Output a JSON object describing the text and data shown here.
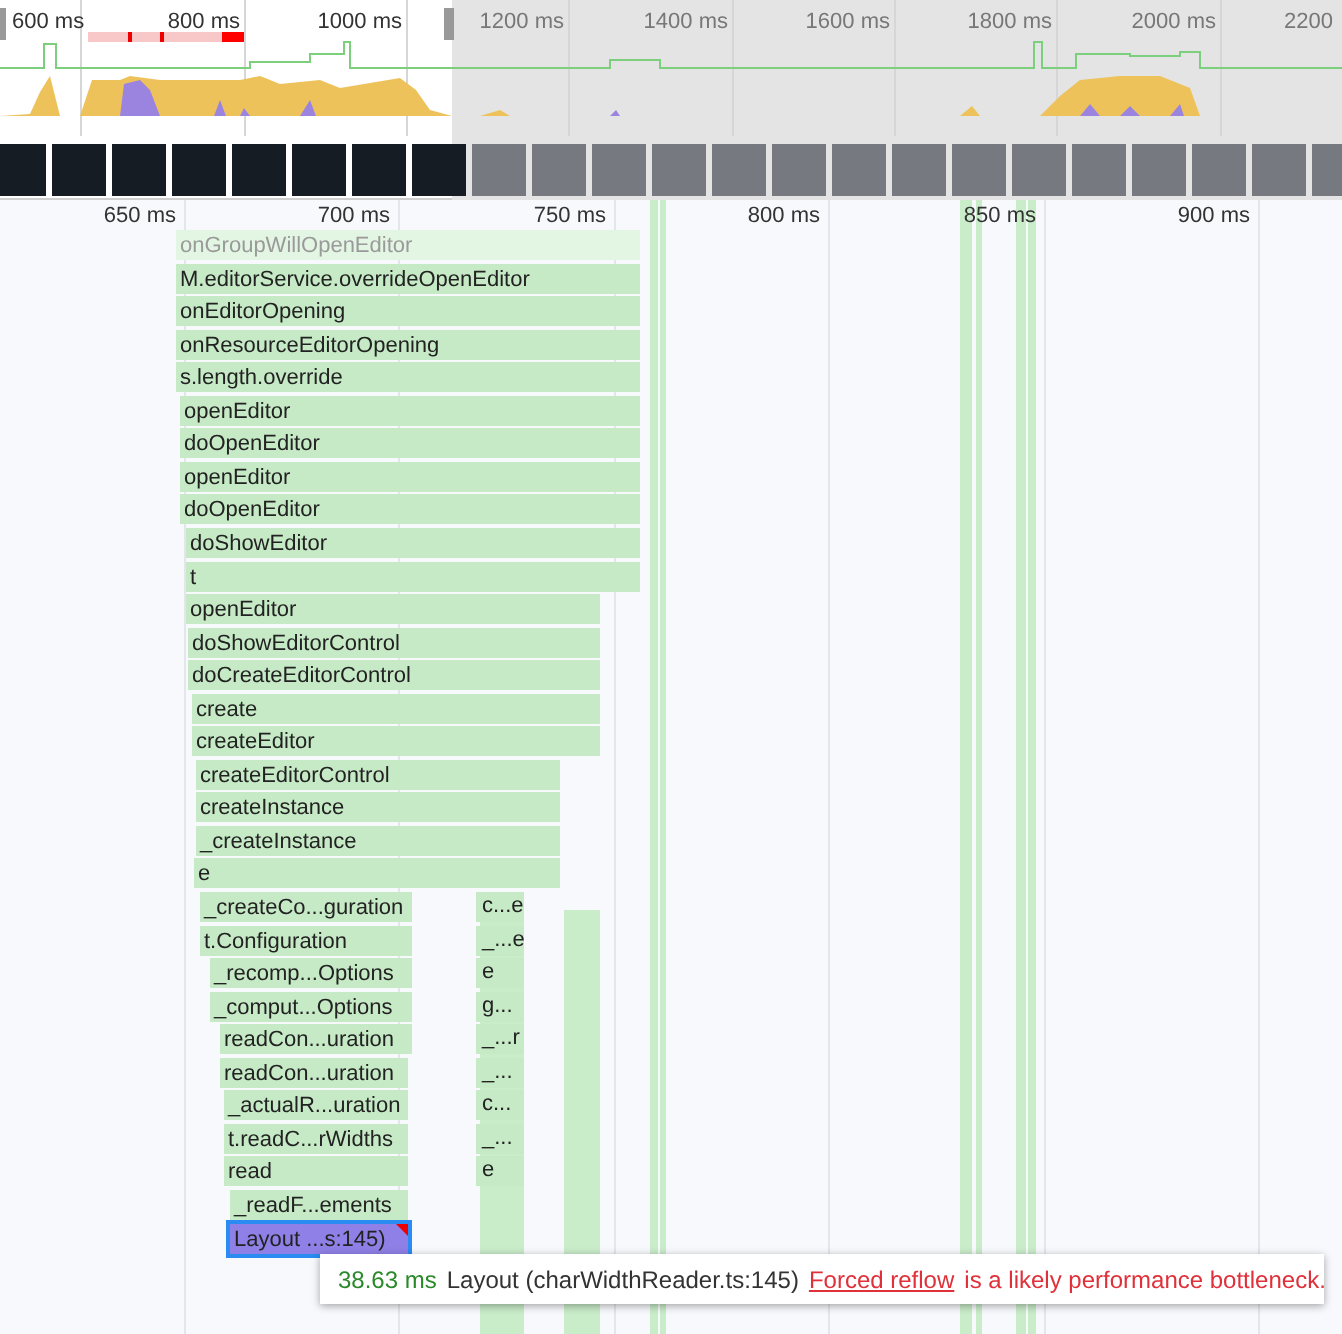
{
  "overview": {
    "ticks": [
      "600 ms",
      "800 ms",
      "1000 ms",
      "1200 ms",
      "1400 ms",
      "1600 ms",
      "1800 ms",
      "2000 ms",
      "2200"
    ]
  },
  "ruler": {
    "ticks": [
      "650 ms",
      "700 ms",
      "750 ms",
      "800 ms",
      "850 ms",
      "900 ms"
    ]
  },
  "flame_rows": [
    {
      "label": "onGroupWillOpenEditor",
      "kind": "dimmed",
      "selected": false
    },
    {
      "label": "M.editorService.overrideOpenEditor",
      "kind": "call",
      "selected": false
    },
    {
      "label": "onEditorOpening",
      "kind": "call",
      "selected": false
    },
    {
      "label": "onResourceEditorOpening",
      "kind": "call",
      "selected": false
    },
    {
      "label": "s.length.override",
      "kind": "call",
      "selected": false
    },
    {
      "label": "openEditor",
      "kind": "call",
      "selected": false
    },
    {
      "label": "doOpenEditor",
      "kind": "call",
      "selected": false
    },
    {
      "label": "openEditor",
      "kind": "call",
      "selected": false
    },
    {
      "label": "doOpenEditor",
      "kind": "call",
      "selected": false
    },
    {
      "label": "doShowEditor",
      "kind": "call",
      "selected": false
    },
    {
      "label": "t",
      "kind": "call",
      "selected": false
    },
    {
      "label": "openEditor",
      "kind": "call",
      "selected": false
    },
    {
      "label": "doShowEditorControl",
      "kind": "call",
      "selected": false
    },
    {
      "label": "doCreateEditorControl",
      "kind": "call",
      "selected": false
    },
    {
      "label": "create",
      "kind": "call",
      "selected": false
    },
    {
      "label": "createEditor",
      "kind": "call",
      "selected": false
    },
    {
      "label": "createEditorControl",
      "kind": "call",
      "selected": false
    },
    {
      "label": "createInstance",
      "kind": "call",
      "selected": false
    },
    {
      "label": "_createInstance",
      "kind": "call",
      "selected": false
    },
    {
      "label": "e",
      "kind": "call",
      "selected": false
    },
    {
      "label": "_createCo...guration",
      "side_label": "c...e",
      "kind": "call",
      "selected": false
    },
    {
      "label": "t.Configuration",
      "side_label": "_...e",
      "kind": "call",
      "selected": false
    },
    {
      "label": "_recomp...Options",
      "side_label": "e",
      "kind": "call",
      "selected": false
    },
    {
      "label": "_comput...Options",
      "side_label": "g...",
      "kind": "call",
      "selected": false
    },
    {
      "label": "readCon...uration",
      "side_label": "_...r",
      "kind": "call",
      "selected": false
    },
    {
      "label": "readCon...uration",
      "side_label": "_...",
      "kind": "call",
      "selected": false
    },
    {
      "label": "_actualR...uration",
      "side_label": "c...",
      "kind": "call",
      "selected": false
    },
    {
      "label": "t.readC...rWidths",
      "side_label": "_...",
      "kind": "call",
      "selected": false
    },
    {
      "label": "read",
      "side_label": "e",
      "kind": "call",
      "selected": false
    },
    {
      "label": "_readF...ements",
      "kind": "call",
      "selected": false
    },
    {
      "label": "Layout ...s:145)",
      "kind": "layout",
      "selected": true
    }
  ],
  "tooltip": {
    "duration": "38.63 ms",
    "title": "Layout (charWidthReader.ts:145)",
    "warning_link": "Forced reflow",
    "warning_text": "is a likely performance bottleneck."
  }
}
